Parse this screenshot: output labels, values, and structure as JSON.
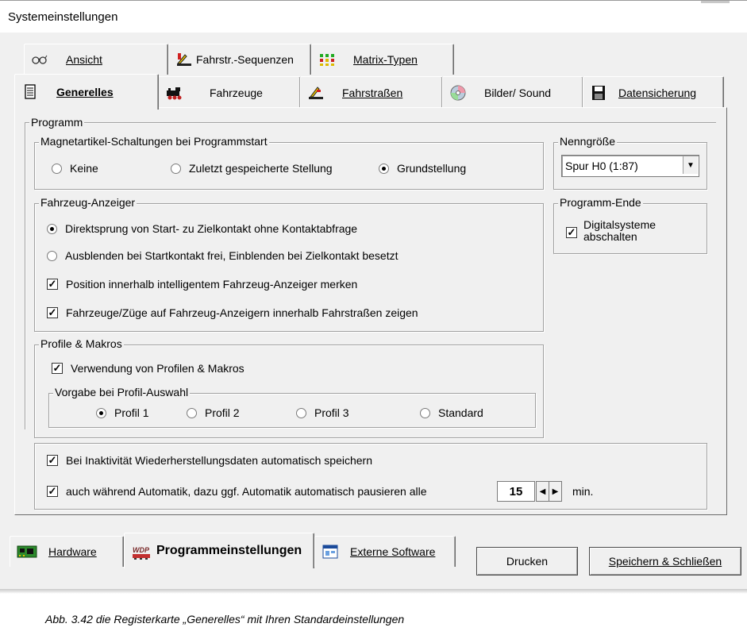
{
  "window": {
    "title": "Systemeinstellungen"
  },
  "tabs_top": [
    {
      "label": "Ansicht",
      "icon": "glasses-icon"
    },
    {
      "label": "Fahrstr.-Sequenzen",
      "icon": "route-sequence-icon"
    },
    {
      "label": "Matrix-Typen",
      "icon": "matrix-grid-icon"
    }
  ],
  "tabs_second": [
    {
      "label": "Generelles",
      "icon": "document-icon",
      "active": true
    },
    {
      "label": "Fahrzeuge",
      "icon": "locomotive-icon"
    },
    {
      "label": "Fahrstraßen",
      "icon": "route-icon"
    },
    {
      "label": "Bilder/ Sound",
      "icon": "cd-icon"
    },
    {
      "label": "Datensicherung",
      "icon": "floppy-icon"
    }
  ],
  "programm": {
    "group_label": "Programm",
    "magnet": {
      "label": "Magnetartikel-Schaltungen bei Programmstart",
      "options": [
        "Keine",
        "Zuletzt gespeicherte Stellung",
        "Grundstellung"
      ],
      "selected": "Grundstellung"
    },
    "fahrzeug_anzeiger": {
      "label": "Fahrzeug-Anzeiger",
      "radio_1": "Direktsprung von Start- zu  Zielkontakt ohne Kontaktabfrage",
      "radio_2": "Ausblenden bei Startkontakt frei, Einblenden bei Zielkontakt besetzt",
      "check_1": "Position innerhalb intelligentem Fahrzeug-Anzeiger merken",
      "check_2": "Fahrzeuge/Züge auf Fahrzeug-Anzeigern innerhalb Fahrstraßen zeigen",
      "selected_radio": 1
    },
    "profile": {
      "label": "Profile & Makros",
      "check": "Verwendung von Profilen  & Makros",
      "vorgabe_label": "Vorgabe bei Profil-Auswahl",
      "options": [
        "Profil 1",
        "Profil 2",
        "Profil 3",
        "Standard"
      ],
      "selected": "Profil 1"
    },
    "nenngroesse": {
      "label": "Nenngröße",
      "value": "Spur H0 (1:87)"
    },
    "programm_ende": {
      "label": "Programm-Ende",
      "check_line1": "Digitalsysteme",
      "check_line2": "abschalten"
    },
    "autosave": {
      "check_1": "Bei Inaktivität Wiederherstellungsdaten automatisch speichern",
      "check_2": "auch während Automatik, dazu ggf. Automatik automatisch pausieren alle",
      "minutes": "15",
      "unit": "min."
    }
  },
  "bottom_tabs": [
    {
      "label": "Hardware",
      "icon": "circuit-board-icon"
    },
    {
      "label": "Programmeinstellungen",
      "icon": "wdp-icon",
      "active": true
    },
    {
      "label": "Externe Software",
      "icon": "window-icon"
    }
  ],
  "buttons": {
    "print": "Drucken",
    "save_close": "Speichern & Schließen"
  },
  "caption": "Abb. 3.42   die Registerkarte „Generelles“ mit Ihren Standardeinstellungen",
  "colors": {
    "window_bg": "#f0f0f0",
    "border_dark": "#6a6a6a",
    "border_light": "#ffffff"
  }
}
